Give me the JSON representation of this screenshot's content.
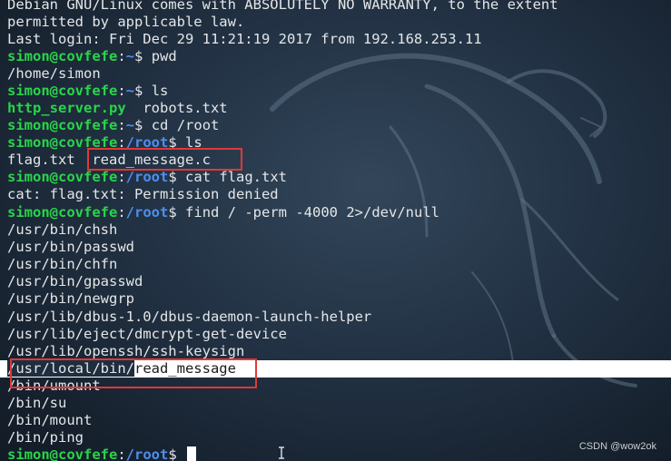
{
  "terminal": {
    "intro": [
      "Debian GNU/Linux comes with ABSOLUTELY NO WARRANTY, to the extent",
      "permitted by applicable law.",
      "Last login: Fri Dec 29 11:21:19 2017 from 192.168.253.11"
    ],
    "prompt_user": "simon@covfefe",
    "prompt_sep": ":",
    "home_dir": "~",
    "root_dir": "/root",
    "prompt_symbol": "$",
    "commands": {
      "pwd": "pwd",
      "ls": "ls",
      "cd": "cd /root",
      "ls_root": "ls",
      "cat": "cat flag.txt",
      "find": "find / -perm -4000 2>/dev/null"
    },
    "outputs": {
      "pwd": "/home/simon",
      "ls_exec": "http_server.py",
      "ls_file": "  robots.txt",
      "ls_root_flag": "flag.txt  ",
      "ls_root_file": "read_message.c",
      "cat": "cat: flag.txt: Permission denied"
    },
    "find_results": [
      "/usr/bin/chsh",
      "/usr/bin/passwd",
      "/usr/bin/chfn",
      "/usr/bin/gpasswd",
      "/usr/bin/newgrp",
      "/usr/lib/dbus-1.0/dbus-daemon-launch-helper",
      "/usr/lib/eject/dmcrypt-get-device",
      "/usr/lib/openssh/ssh-keysign"
    ],
    "highlight_prefix": "/usr/local/bin/",
    "highlight_name": "read_message",
    "find_results_after": [
      "/bin/umount",
      "/bin/su",
      "/bin/mount",
      "/bin/ping"
    ]
  },
  "colors": {
    "user": "#2ad44a",
    "path": "#4d8ff0",
    "annotation_box": "#e03838",
    "selection": "#ffffff"
  },
  "watermark": "CSDN @wow2ok"
}
